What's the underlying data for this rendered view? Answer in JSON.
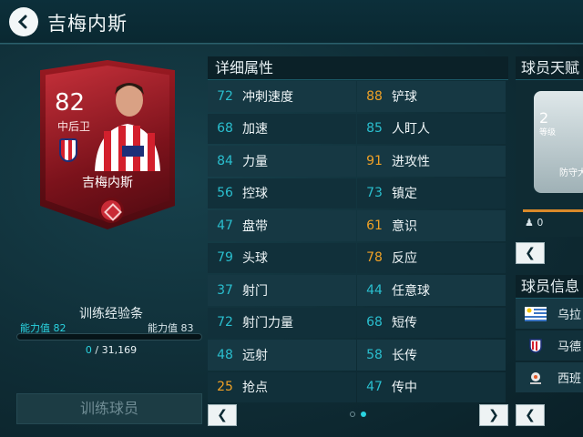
{
  "header": {
    "title": "吉梅内斯",
    "back_icon": "chevron-left-icon"
  },
  "card": {
    "rating": "82",
    "position": "中后卫",
    "name": "吉梅内斯",
    "club_icon": "atletico-madrid-crest-icon"
  },
  "training": {
    "title": "训练经验条",
    "ability_label_left": "能力值",
    "ability_value_left": "82",
    "ability_label_right": "能力值",
    "ability_value_right": "83",
    "exp_current": "0",
    "exp_total": "31,169",
    "exp_progress": 0,
    "train_button": "训练球员"
  },
  "attributes": {
    "title": "详细属性",
    "rows": [
      [
        {
          "value": "72",
          "name": "冲刺速度",
          "color": "teal"
        },
        {
          "value": "88",
          "name": "铲球",
          "color": "orange"
        }
      ],
      [
        {
          "value": "68",
          "name": "加速",
          "color": "teal"
        },
        {
          "value": "85",
          "name": "人盯人",
          "color": "teal"
        }
      ],
      [
        {
          "value": "84",
          "name": "力量",
          "color": "teal"
        },
        {
          "value": "91",
          "name": "进攻性",
          "color": "orange"
        }
      ],
      [
        {
          "value": "56",
          "name": "控球",
          "color": "teal"
        },
        {
          "value": "73",
          "name": "镇定",
          "color": "teal"
        }
      ],
      [
        {
          "value": "47",
          "name": "盘带",
          "color": "teal"
        },
        {
          "value": "61",
          "name": "意识",
          "color": "orange"
        }
      ],
      [
        {
          "value": "79",
          "name": "头球",
          "color": "teal"
        },
        {
          "value": "78",
          "name": "反应",
          "color": "orange"
        }
      ],
      [
        {
          "value": "37",
          "name": "射门",
          "color": "teal"
        },
        {
          "value": "44",
          "name": "任意球",
          "color": "teal"
        }
      ],
      [
        {
          "value": "72",
          "name": "射门力量",
          "color": "teal"
        },
        {
          "value": "68",
          "name": "短传",
          "color": "teal"
        }
      ],
      [
        {
          "value": "48",
          "name": "远射",
          "color": "teal"
        },
        {
          "value": "58",
          "name": "长传",
          "color": "teal"
        }
      ],
      [
        {
          "value": "25",
          "name": "抢点",
          "color": "orange"
        },
        {
          "value": "47",
          "name": "传中",
          "color": "teal"
        }
      ]
    ],
    "page_current": 2,
    "page_total": 2
  },
  "talent": {
    "title": "球员天赋",
    "level": "2",
    "level_label": "等级",
    "name": "防守大",
    "count": "0"
  },
  "info": {
    "title": "球员信息",
    "items": [
      {
        "flag": "uruguay-flag-icon",
        "text": "乌拉"
      },
      {
        "flag": "atletico-madrid-crest-icon",
        "text": "马德"
      },
      {
        "flag": "laliga-logo-icon",
        "text": "西班"
      }
    ]
  },
  "colors": {
    "teal": "#2abfcf",
    "orange": "#f0a126",
    "card_red": "#9b1a22"
  }
}
